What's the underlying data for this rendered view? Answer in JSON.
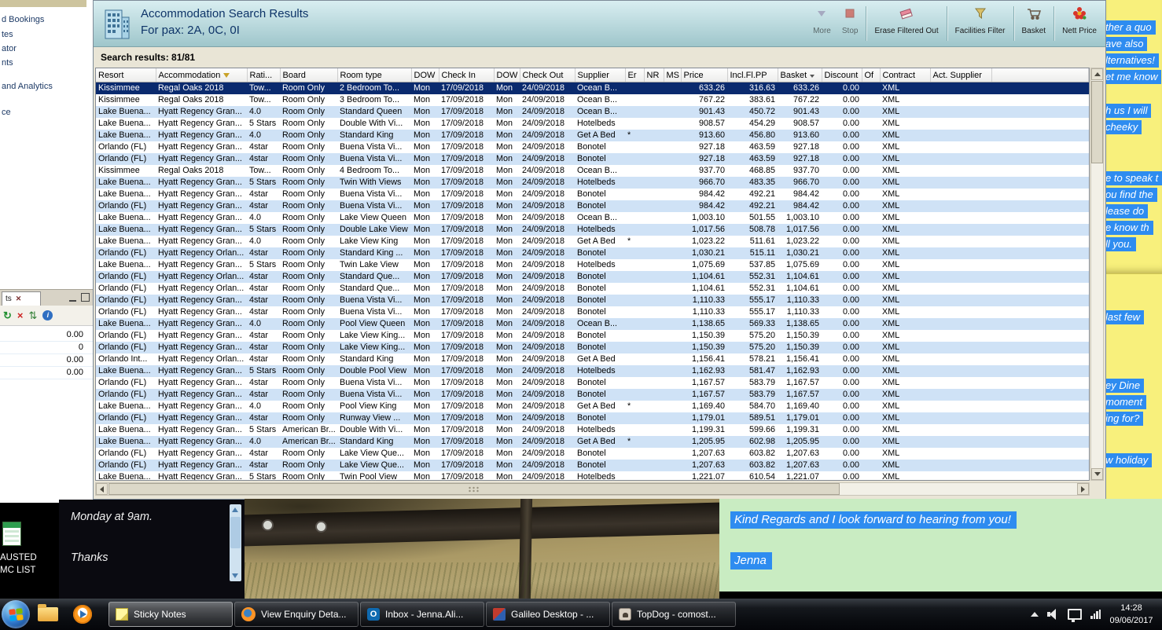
{
  "colors": {
    "selected_row": "#0a2a6e",
    "alt_row": "#cfe2f6",
    "header_teal_top": "#d9eef1",
    "header_teal_bottom": "#9fc6cb",
    "highlight_blue": "#2e8cf0",
    "sticky_yellow": "#f8f07c",
    "sticky_green": "#c9ecc2"
  },
  "left_app": {
    "menu_items": [
      "d Bookings",
      "tes",
      "ator",
      "nts",
      "and Analytics",
      "ce"
    ],
    "subpanel": {
      "tab": "ts",
      "values": [
        "0.00",
        "0",
        "0.00",
        "0.00"
      ]
    },
    "desktop_label": [
      "AUSTED",
      "MC LIST"
    ]
  },
  "main_window": {
    "title": "Accommodation Search Results",
    "subtitle": "For pax: 2A, 0C, 0I",
    "toolbar": {
      "more": "More",
      "stop": "Stop",
      "erase": "Erase Filtered Out",
      "facilities": "Facilities Filter",
      "basket": "Basket",
      "nett": "Nett Price"
    },
    "results_label": "Search results: 81/81",
    "table": {
      "selected_index": 0,
      "columns": [
        {
          "label": "Resort"
        },
        {
          "label": "Accommodation",
          "filter": true
        },
        {
          "label": "Rati..."
        },
        {
          "label": "Board"
        },
        {
          "label": "Room type"
        },
        {
          "label": "DOW"
        },
        {
          "label": "Check In"
        },
        {
          "label": "DOW"
        },
        {
          "label": "Check Out"
        },
        {
          "label": "Supplier"
        },
        {
          "label": "Er"
        },
        {
          "label": "NR"
        },
        {
          "label": "MS"
        },
        {
          "label": "Price"
        },
        {
          "label": "Incl.Fl.PP"
        },
        {
          "label": "Basket",
          "sort": true
        },
        {
          "label": "Discount"
        },
        {
          "label": "Of"
        },
        {
          "label": "Contract"
        },
        {
          "label": "Act. Supplier"
        }
      ],
      "rows": [
        [
          "Kissimmee",
          "Regal Oaks 2018",
          "Tow...",
          "Room Only",
          "2 Bedroom To...",
          "Mon",
          "17/09/2018",
          "Mon",
          "24/09/2018",
          "Ocean B...",
          "",
          "",
          "",
          "633.26",
          "316.63",
          "633.26",
          "0.00",
          "",
          "XML",
          ""
        ],
        [
          "Kissimmee",
          "Regal Oaks 2018",
          "Tow...",
          "Room Only",
          "3 Bedroom To...",
          "Mon",
          "17/09/2018",
          "Mon",
          "24/09/2018",
          "Ocean B...",
          "",
          "",
          "",
          "767.22",
          "383.61",
          "767.22",
          "0.00",
          "",
          "XML",
          ""
        ],
        [
          "Lake Buena...",
          "Hyatt Regency Gran...",
          "4.0",
          "Room Only",
          "Standard Queen",
          "Mon",
          "17/09/2018",
          "Mon",
          "24/09/2018",
          "Ocean B...",
          "",
          "",
          "",
          "901.43",
          "450.72",
          "901.43",
          "0.00",
          "",
          "XML",
          ""
        ],
        [
          "Lake Buena...",
          "Hyatt Regency Gran...",
          "5 Stars",
          "Room Only",
          "Double With Vi...",
          "Mon",
          "17/09/2018",
          "Mon",
          "24/09/2018",
          "Hotelbeds",
          "",
          "",
          "",
          "908.57",
          "454.29",
          "908.57",
          "0.00",
          "",
          "XML",
          ""
        ],
        [
          "Lake Buena...",
          "Hyatt Regency Gran...",
          "4.0",
          "Room Only",
          "Standard King",
          "Mon",
          "17/09/2018",
          "Mon",
          "24/09/2018",
          "Get A Bed",
          "*",
          "",
          "",
          "913.60",
          "456.80",
          "913.60",
          "0.00",
          "",
          "XML",
          ""
        ],
        [
          "Orlando (FL)",
          "Hyatt Regency Gran...",
          "4star",
          "Room Only",
          "Buena Vista Vi...",
          "Mon",
          "17/09/2018",
          "Mon",
          "24/09/2018",
          "Bonotel",
          "",
          "",
          "",
          "927.18",
          "463.59",
          "927.18",
          "0.00",
          "",
          "XML",
          ""
        ],
        [
          "Orlando (FL)",
          "Hyatt Regency Gran...",
          "4star",
          "Room Only",
          "Buena Vista Vi...",
          "Mon",
          "17/09/2018",
          "Mon",
          "24/09/2018",
          "Bonotel",
          "",
          "",
          "",
          "927.18",
          "463.59",
          "927.18",
          "0.00",
          "",
          "XML",
          ""
        ],
        [
          "Kissimmee",
          "Regal Oaks 2018",
          "Tow...",
          "Room Only",
          "4 Bedroom To...",
          "Mon",
          "17/09/2018",
          "Mon",
          "24/09/2018",
          "Ocean B...",
          "",
          "",
          "",
          "937.70",
          "468.85",
          "937.70",
          "0.00",
          "",
          "XML",
          ""
        ],
        [
          "Lake Buena...",
          "Hyatt Regency Gran...",
          "5 Stars",
          "Room Only",
          "Twin With Views",
          "Mon",
          "17/09/2018",
          "Mon",
          "24/09/2018",
          "Hotelbeds",
          "",
          "",
          "",
          "966.70",
          "483.35",
          "966.70",
          "0.00",
          "",
          "XML",
          ""
        ],
        [
          "Lake Buena...",
          "Hyatt Regency Gran...",
          "4star",
          "Room Only",
          "Buena Vista Vi...",
          "Mon",
          "17/09/2018",
          "Mon",
          "24/09/2018",
          "Bonotel",
          "",
          "",
          "",
          "984.42",
          "492.21",
          "984.42",
          "0.00",
          "",
          "XML",
          ""
        ],
        [
          "Orlando (FL)",
          "Hyatt Regency Gran...",
          "4star",
          "Room Only",
          "Buena Vista Vi...",
          "Mon",
          "17/09/2018",
          "Mon",
          "24/09/2018",
          "Bonotel",
          "",
          "",
          "",
          "984.42",
          "492.21",
          "984.42",
          "0.00",
          "",
          "XML",
          ""
        ],
        [
          "Lake Buena...",
          "Hyatt Regency Gran...",
          "4.0",
          "Room Only",
          "Lake View Queen",
          "Mon",
          "17/09/2018",
          "Mon",
          "24/09/2018",
          "Ocean B...",
          "",
          "",
          "",
          "1,003.10",
          "501.55",
          "1,003.10",
          "0.00",
          "",
          "XML",
          ""
        ],
        [
          "Lake Buena...",
          "Hyatt Regency Gran...",
          "5 Stars",
          "Room Only",
          "Double Lake View",
          "Mon",
          "17/09/2018",
          "Mon",
          "24/09/2018",
          "Hotelbeds",
          "",
          "",
          "",
          "1,017.56",
          "508.78",
          "1,017.56",
          "0.00",
          "",
          "XML",
          ""
        ],
        [
          "Lake Buena...",
          "Hyatt Regency Gran...",
          "4.0",
          "Room Only",
          "Lake View King",
          "Mon",
          "17/09/2018",
          "Mon",
          "24/09/2018",
          "Get A Bed",
          "*",
          "",
          "",
          "1,023.22",
          "511.61",
          "1,023.22",
          "0.00",
          "",
          "XML",
          ""
        ],
        [
          "Orlando (FL)",
          "Hyatt Regency Orlan...",
          "4star",
          "Room Only",
          "Standard King ...",
          "Mon",
          "17/09/2018",
          "Mon",
          "24/09/2018",
          "Bonotel",
          "",
          "",
          "",
          "1,030.21",
          "515.11",
          "1,030.21",
          "0.00",
          "",
          "XML",
          ""
        ],
        [
          "Lake Buena...",
          "Hyatt Regency Gran...",
          "5 Stars",
          "Room Only",
          "Twin Lake View",
          "Mon",
          "17/09/2018",
          "Mon",
          "24/09/2018",
          "Hotelbeds",
          "",
          "",
          "",
          "1,075.69",
          "537.85",
          "1,075.69",
          "0.00",
          "",
          "XML",
          ""
        ],
        [
          "Orlando (FL)",
          "Hyatt Regency Orlan...",
          "4star",
          "Room Only",
          "Standard Que...",
          "Mon",
          "17/09/2018",
          "Mon",
          "24/09/2018",
          "Bonotel",
          "",
          "",
          "",
          "1,104.61",
          "552.31",
          "1,104.61",
          "0.00",
          "",
          "XML",
          ""
        ],
        [
          "Orlando (FL)",
          "Hyatt Regency Orlan...",
          "4star",
          "Room Only",
          "Standard Que...",
          "Mon",
          "17/09/2018",
          "Mon",
          "24/09/2018",
          "Bonotel",
          "",
          "",
          "",
          "1,104.61",
          "552.31",
          "1,104.61",
          "0.00",
          "",
          "XML",
          ""
        ],
        [
          "Orlando (FL)",
          "Hyatt Regency Gran...",
          "4star",
          "Room Only",
          "Buena Vista Vi...",
          "Mon",
          "17/09/2018",
          "Mon",
          "24/09/2018",
          "Bonotel",
          "",
          "",
          "",
          "1,110.33",
          "555.17",
          "1,110.33",
          "0.00",
          "",
          "XML",
          ""
        ],
        [
          "Orlando (FL)",
          "Hyatt Regency Gran...",
          "4star",
          "Room Only",
          "Buena Vista Vi...",
          "Mon",
          "17/09/2018",
          "Mon",
          "24/09/2018",
          "Bonotel",
          "",
          "",
          "",
          "1,110.33",
          "555.17",
          "1,110.33",
          "0.00",
          "",
          "XML",
          ""
        ],
        [
          "Lake Buena...",
          "Hyatt Regency Gran...",
          "4.0",
          "Room Only",
          "Pool View Queen",
          "Mon",
          "17/09/2018",
          "Mon",
          "24/09/2018",
          "Ocean B...",
          "",
          "",
          "",
          "1,138.65",
          "569.33",
          "1,138.65",
          "0.00",
          "",
          "XML",
          ""
        ],
        [
          "Orlando (FL)",
          "Hyatt Regency Gran...",
          "4star",
          "Room Only",
          "Lake View King...",
          "Mon",
          "17/09/2018",
          "Mon",
          "24/09/2018",
          "Bonotel",
          "",
          "",
          "",
          "1,150.39",
          "575.20",
          "1,150.39",
          "0.00",
          "",
          "XML",
          ""
        ],
        [
          "Orlando (FL)",
          "Hyatt Regency Gran...",
          "4star",
          "Room Only",
          "Lake View King...",
          "Mon",
          "17/09/2018",
          "Mon",
          "24/09/2018",
          "Bonotel",
          "",
          "",
          "",
          "1,150.39",
          "575.20",
          "1,150.39",
          "0.00",
          "",
          "XML",
          ""
        ],
        [
          "Orlando Int...",
          "Hyatt Regency Orlan...",
          "4star",
          "Room Only",
          "Standard King",
          "Mon",
          "17/09/2018",
          "Mon",
          "24/09/2018",
          "Get A Bed",
          "",
          "",
          "",
          "1,156.41",
          "578.21",
          "1,156.41",
          "0.00",
          "",
          "XML",
          ""
        ],
        [
          "Lake Buena...",
          "Hyatt Regency Gran...",
          "5 Stars",
          "Room Only",
          "Double Pool View",
          "Mon",
          "17/09/2018",
          "Mon",
          "24/09/2018",
          "Hotelbeds",
          "",
          "",
          "",
          "1,162.93",
          "581.47",
          "1,162.93",
          "0.00",
          "",
          "XML",
          ""
        ],
        [
          "Orlando (FL)",
          "Hyatt Regency Gran...",
          "4star",
          "Room Only",
          "Buena Vista Vi...",
          "Mon",
          "17/09/2018",
          "Mon",
          "24/09/2018",
          "Bonotel",
          "",
          "",
          "",
          "1,167.57",
          "583.79",
          "1,167.57",
          "0.00",
          "",
          "XML",
          ""
        ],
        [
          "Orlando (FL)",
          "Hyatt Regency Gran...",
          "4star",
          "Room Only",
          "Buena Vista Vi...",
          "Mon",
          "17/09/2018",
          "Mon",
          "24/09/2018",
          "Bonotel",
          "",
          "",
          "",
          "1,167.57",
          "583.79",
          "1,167.57",
          "0.00",
          "",
          "XML",
          ""
        ],
        [
          "Lake Buena...",
          "Hyatt Regency Gran...",
          "4.0",
          "Room Only",
          "Pool View King",
          "Mon",
          "17/09/2018",
          "Mon",
          "24/09/2018",
          "Get A Bed",
          "*",
          "",
          "",
          "1,169.40",
          "584.70",
          "1,169.40",
          "0.00",
          "",
          "XML",
          ""
        ],
        [
          "Orlando (FL)",
          "Hyatt Regency Gran...",
          "4star",
          "Room Only",
          "Runway View ...",
          "Mon",
          "17/09/2018",
          "Mon",
          "24/09/2018",
          "Bonotel",
          "",
          "",
          "",
          "1,179.01",
          "589.51",
          "1,179.01",
          "0.00",
          "",
          "XML",
          ""
        ],
        [
          "Lake Buena...",
          "Hyatt Regency Gran...",
          "5 Stars",
          "American Br...",
          "Double With Vi...",
          "Mon",
          "17/09/2018",
          "Mon",
          "24/09/2018",
          "Hotelbeds",
          "",
          "",
          "",
          "1,199.31",
          "599.66",
          "1,199.31",
          "0.00",
          "",
          "XML",
          ""
        ],
        [
          "Lake Buena...",
          "Hyatt Regency Gran...",
          "4.0",
          "American Br...",
          "Standard King",
          "Mon",
          "17/09/2018",
          "Mon",
          "24/09/2018",
          "Get A Bed",
          "*",
          "",
          "",
          "1,205.95",
          "602.98",
          "1,205.95",
          "0.00",
          "",
          "XML",
          ""
        ],
        [
          "Orlando (FL)",
          "Hyatt Regency Gran...",
          "4star",
          "Room Only",
          "Lake View Que...",
          "Mon",
          "17/09/2018",
          "Mon",
          "24/09/2018",
          "Bonotel",
          "",
          "",
          "",
          "1,207.63",
          "603.82",
          "1,207.63",
          "0.00",
          "",
          "XML",
          ""
        ],
        [
          "Orlando (FL)",
          "Hyatt Regency Gran...",
          "4star",
          "Room Only",
          "Lake View Que...",
          "Mon",
          "17/09/2018",
          "Mon",
          "24/09/2018",
          "Bonotel",
          "",
          "",
          "",
          "1,207.63",
          "603.82",
          "1,207.63",
          "0.00",
          "",
          "XML",
          ""
        ],
        [
          "Lake Buena...",
          "Hyatt Regency Gran...",
          "5 Stars",
          "Room Only",
          "Twin Pool View",
          "Mon",
          "17/09/2018",
          "Mon",
          "24/09/2018",
          "Hotelbeds",
          "",
          "",
          "",
          "1,221.07",
          "610.54",
          "1,221.07",
          "0.00",
          "",
          "XML",
          ""
        ]
      ]
    }
  },
  "sticky_notes": {
    "right_top": {
      "groups": [
        [
          "ther a quo",
          "ave also",
          "lternatives!",
          "et me know"
        ],
        [
          "h us I will",
          "cheeky"
        ],
        [
          "e to speak t",
          "ou find the",
          "lease do",
          "e know th",
          "ll you."
        ]
      ]
    },
    "right_bottom": {
      "groups": [
        [
          "last few"
        ],
        [
          "ey Dine",
          "moment",
          "ing for?"
        ],
        [
          "w holiday"
        ]
      ]
    },
    "dark_note": {
      "lines": [
        "Monday at 9am.",
        "Thanks"
      ]
    },
    "green_note": {
      "lines": [
        "Kind Regards and I look forward to hearing from you!",
        "Jenna"
      ]
    }
  },
  "taskbar": {
    "buttons": [
      {
        "label": "Sticky Notes",
        "icon": "sticky-notes",
        "active": true
      },
      {
        "label": "View Enquiry Deta...",
        "icon": "firefox"
      },
      {
        "label": "Inbox - Jenna.Ali...",
        "icon": "outlook"
      },
      {
        "label": "Galileo Desktop - ...",
        "icon": "galileo"
      },
      {
        "label": "TopDog - comost...",
        "icon": "topdog"
      }
    ],
    "clock": {
      "time": "14:28",
      "date": "09/06/2017"
    }
  }
}
